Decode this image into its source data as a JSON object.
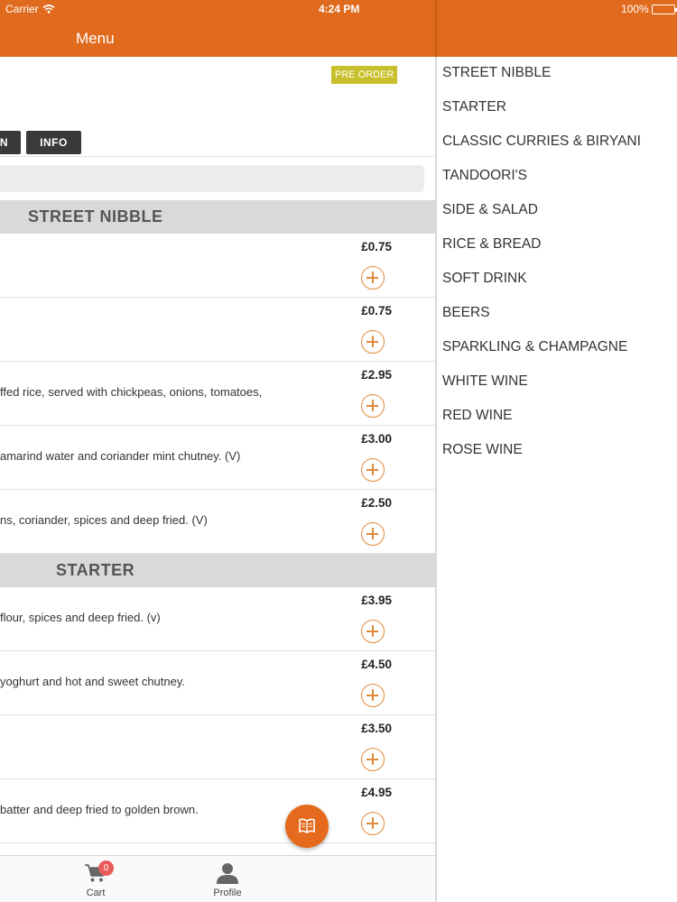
{
  "status_bar": {
    "carrier": "Carrier",
    "time": "4:24 PM",
    "battery": "100%"
  },
  "header": {
    "title": "Menu"
  },
  "badges": {
    "pre_order": "PRE ORDER"
  },
  "tabs": {
    "menu_partial": "N",
    "info": "INFO"
  },
  "sections": [
    {
      "title": "STREET NIBBLE",
      "items": [
        {
          "desc": "",
          "price": "£0.75"
        },
        {
          "desc": "",
          "price": "£0.75"
        },
        {
          "desc": "ffed rice, served with chickpeas, onions, tomatoes,",
          "price": "£2.95"
        },
        {
          "desc": "amarind water and coriander mint chutney. (V)",
          "price": "£3.00"
        },
        {
          "desc": "ns, coriander, spices and deep fried. (V)",
          "price": "£2.50"
        }
      ]
    },
    {
      "title": "STARTER",
      "items": [
        {
          "desc": "flour, spices and deep fried. (v)",
          "price": "£3.95"
        },
        {
          "desc": "yoghurt and hot and sweet chutney.",
          "price": "£4.50"
        },
        {
          "desc": "",
          "price": "£3.50"
        },
        {
          "desc": "batter and deep fried to golden brown.",
          "price": "£4.95"
        }
      ]
    }
  ],
  "tabbar": {
    "cart_label": "Cart",
    "cart_count": "0",
    "profile_label": "Profile"
  },
  "categories": [
    "STREET NIBBLE",
    "STARTER",
    "CLASSIC CURRIES & BIRYANI",
    "TANDOORI'S",
    "SIDE & SALAD",
    "RICE & BREAD",
    "SOFT DRINK",
    "BEERS",
    "SPARKLING & CHAMPAGNE",
    "WHITE WINE",
    "RED WINE",
    "ROSE WINE"
  ],
  "colors": {
    "brand": "#e06b1e",
    "accent_outline": "#e08a3c",
    "pre_order": "#c8c02a",
    "badge": "#e85a5a"
  },
  "icons": {
    "fab": "menu-book-icon",
    "cart": "cart-icon",
    "profile": "profile-icon",
    "add": "add-circle-icon"
  }
}
